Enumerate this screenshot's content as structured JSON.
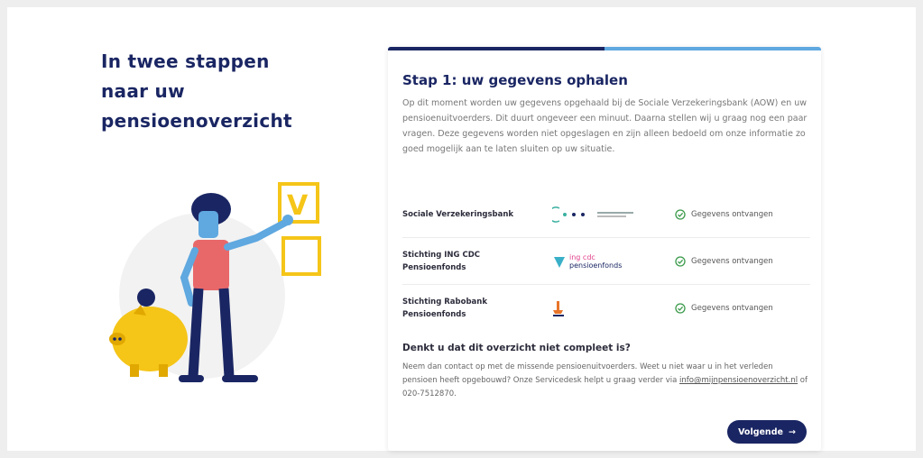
{
  "left": {
    "headline_lines": [
      "In twee stappen",
      "naar uw",
      "pensioenoverzicht"
    ]
  },
  "card": {
    "progress_fraction": 0.5,
    "title": "Stap 1: uw gegevens ophalen",
    "intro": "Op dit moment worden uw gegevens opgehaald bij de Sociale Verzekeringsbank (AOW) en uw pensioenuitvoerders. Dit duurt ongeveer een minuut. Daarna stellen wij u graag nog een paar vragen. Deze gegevens worden niet opgeslagen en zijn alleen bedoeld om onze informatie zo goed mogelijk aan te laten sluiten op uw situatie.",
    "providers": [
      {
        "name_lines": [
          "Sociale Verzekeringsbank"
        ],
        "logo": "svb-logo",
        "status": "Gegevens ontvangen"
      },
      {
        "name_lines": [
          "Stichting ING CDC",
          "Pensioenfonds"
        ],
        "logo": "ing-cdc-logo",
        "logo_text_1": "ing cdc",
        "logo_text_2": "pensioenfonds",
        "status": "Gegevens ontvangen"
      },
      {
        "name_lines": [
          "Stichting Rabobank",
          "Pensioenfonds"
        ],
        "logo": "rabobank-logo",
        "status": "Gegevens ontvangen"
      }
    ],
    "incomplete": {
      "title": "Denkt u dat dit overzicht niet compleet is?",
      "text": "Neem dan contact op met de missende pensioenuitvoerders. Weet u niet waar u in het verleden pensioen heeft opgebouwd? Onze Servicedesk helpt u graag verder via",
      "email": "info@mijnpensioenoverzicht.nl",
      "phone_text": "of 020-7512870."
    },
    "next_label": "Volgende",
    "next_arrow": "→"
  },
  "colors": {
    "navy": "#1a2663",
    "light_blue": "#5fa8e0",
    "yellow": "#f5c518",
    "check_green": "#3a9a4a"
  }
}
